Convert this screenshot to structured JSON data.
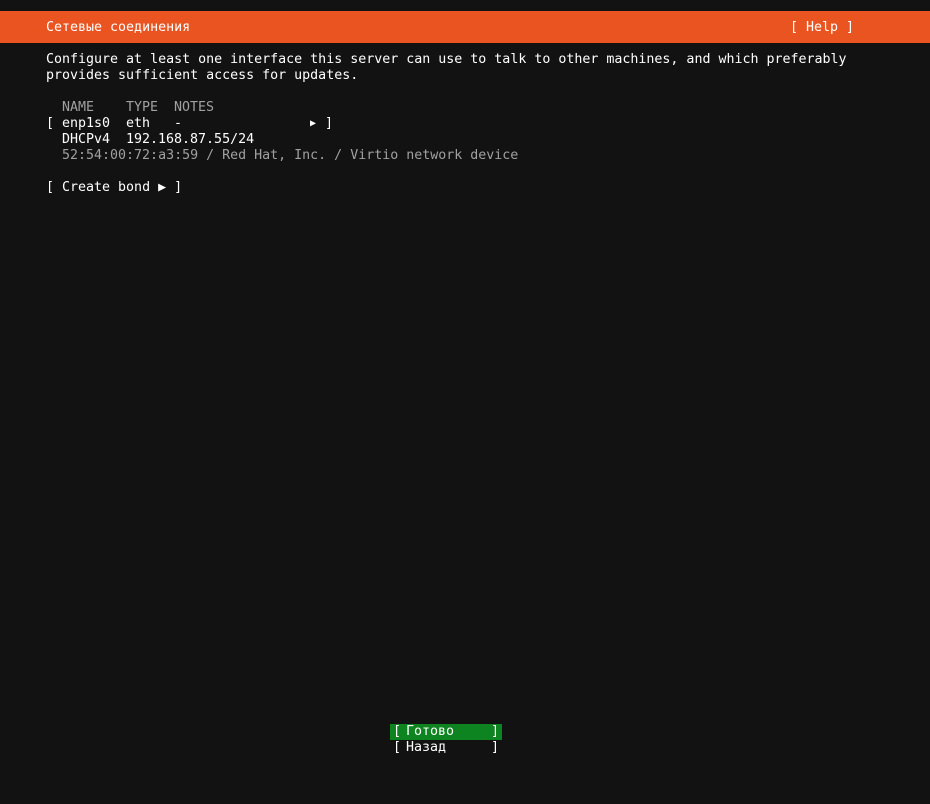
{
  "header": {
    "title": "Сетевые соединения",
    "help_label": "[ Help ]"
  },
  "description": {
    "line1": "Configure at least one interface this server can use to talk to other machines, and which preferably",
    "line2": "provides sufficient access for updates."
  },
  "table": {
    "columns": {
      "name": "NAME",
      "type": "TYPE",
      "notes": "NOTES"
    },
    "interface": {
      "open_bracket": "[",
      "name": "enp1s0",
      "type": "eth",
      "notes": "-",
      "arrow": "▶",
      "close_bracket": "]",
      "address_method": "DHCPv4",
      "address": "192.168.87.55/24",
      "hardware": "52:54:00:72:a3:59 / Red Hat, Inc. / Virtio network device"
    }
  },
  "create_bond": {
    "label": "[ Create bond ▶ ]"
  },
  "buttons": {
    "done": {
      "open": "[",
      "label": "Готово",
      "close": "]"
    },
    "back": {
      "open": "[",
      "label": "Назад",
      "close": "]"
    }
  },
  "colors": {
    "accent": "#e95420",
    "background": "#121212",
    "done_button": "#0e8420",
    "dim_text": "#a0a0a0"
  }
}
